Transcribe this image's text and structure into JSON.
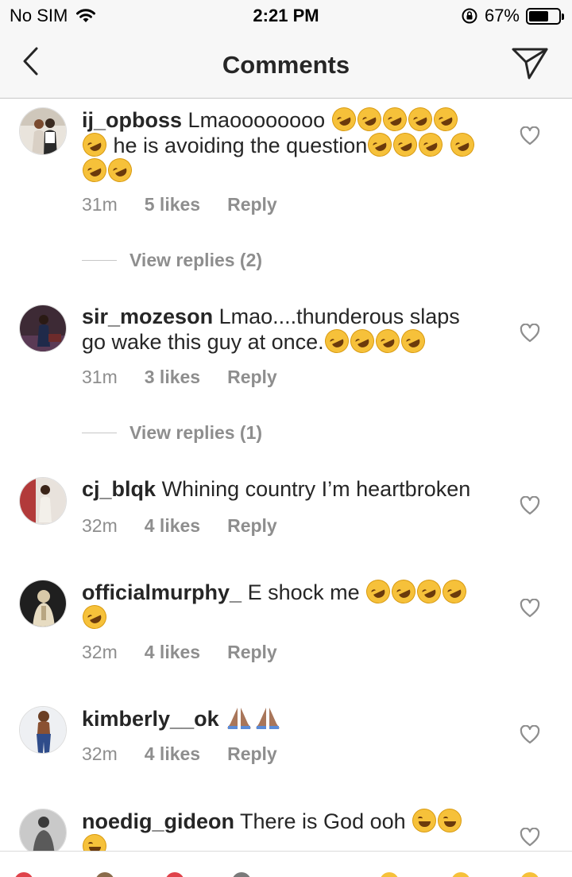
{
  "status_bar": {
    "carrier": "No SIM",
    "time": "2:21 PM",
    "battery": "67%"
  },
  "nav": {
    "title": "Comments"
  },
  "comments": [
    {
      "username": "ij_opboss",
      "text_1": "Lmaoooooooo",
      "text_2": "he is avoiding the question",
      "time": "31m",
      "likes": "5 likes",
      "reply": "Reply",
      "view_replies": "View replies (2)"
    },
    {
      "username": "sir_mozeson",
      "text_1": "Lmao....thunderous slaps go wake this guy at once.",
      "time": "31m",
      "likes": "3 likes",
      "reply": "Reply",
      "view_replies": "View replies (1)"
    },
    {
      "username": "cj_blqk",
      "text_1": "Whining country I’m heartbroken",
      "time": "32m",
      "likes": "4 likes",
      "reply": "Reply"
    },
    {
      "username": "officialmurphy_",
      "text_1": "E shock me",
      "time": "32m",
      "likes": "4 likes",
      "reply": "Reply"
    },
    {
      "username": "kimberly__ok",
      "text_1": "",
      "time": "32m",
      "likes": "4 likes",
      "reply": "Reply"
    },
    {
      "username": "noedig_gideon",
      "text_1": "There is God ooh"
    }
  ],
  "icons": {
    "back": "chevron-left-icon",
    "share": "paper-plane-icon",
    "like": "heart-outline-icon",
    "wifi": "wifi-icon",
    "lock": "orientation-lock-icon"
  },
  "colors": {
    "text": "#262626",
    "meta": "#8e8e8e",
    "bar_bg": "#f7f7f7"
  }
}
